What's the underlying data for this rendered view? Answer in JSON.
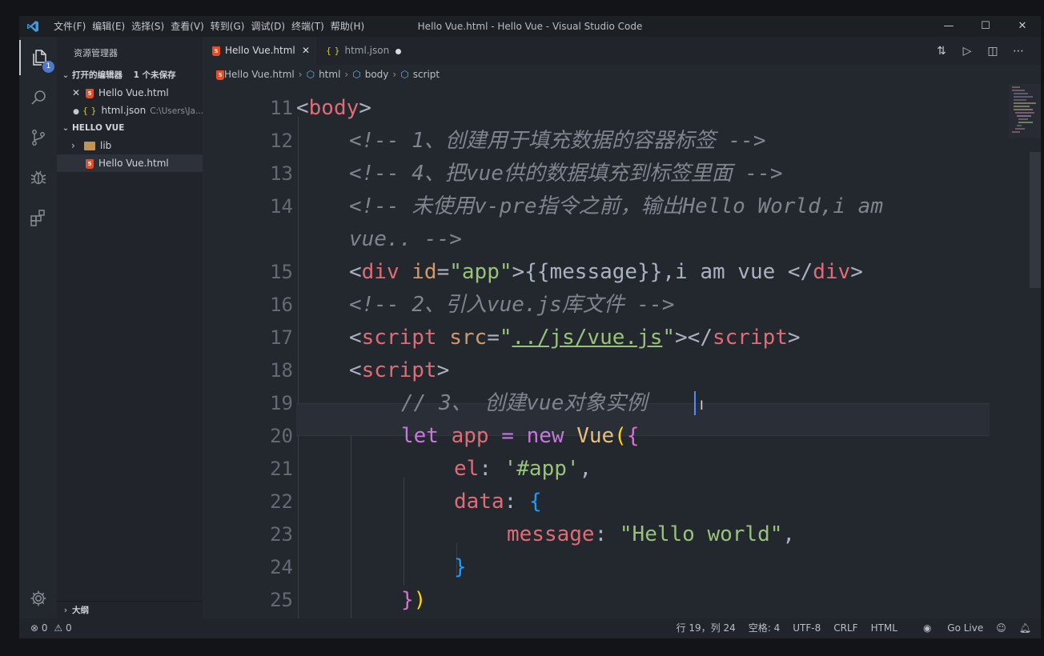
{
  "window": {
    "title": "Hello Vue.html - Hello Vue - Visual Studio Code",
    "menus": [
      "文件(F)",
      "编辑(E)",
      "选择(S)",
      "查看(V)",
      "转到(G)",
      "调试(D)",
      "终端(T)",
      "帮助(H)"
    ],
    "controls": [
      "—",
      "☐",
      "✕"
    ]
  },
  "activity": {
    "badge": "1",
    "icons": [
      "files-icon",
      "search-icon",
      "source-control-icon",
      "debug-icon",
      "extensions-icon"
    ]
  },
  "sidebar": {
    "title": "资源管理器",
    "open_editors": {
      "label": "打开的编辑器",
      "unsaved": "1 个未保存",
      "items": [
        {
          "name": "Hello Vue.html",
          "close": "✕"
        },
        {
          "name": "html.json",
          "path": "C:\\Users\\Ja..."
        }
      ]
    },
    "project": {
      "label": "HELLO VUE",
      "folders": [
        {
          "name": "lib"
        }
      ],
      "files": [
        {
          "name": "Hello Vue.html"
        }
      ]
    },
    "outline": "大纲"
  },
  "tabs": [
    {
      "label": "Hello Vue.html",
      "close": "✕"
    },
    {
      "label": "html.json"
    }
  ],
  "breadcrumbs": [
    "Hello Vue.html",
    "html",
    "body",
    "script"
  ],
  "editor": {
    "lines": [
      {
        "no": "11",
        "code": [
          "<",
          "body",
          ">"
        ]
      },
      {
        "no": "12",
        "comment": "<!-- 1、创建用于填充数据的容器标签 -->"
      },
      {
        "no": "13",
        "comment": "<!-- 4、把vue供的数据填充到标签里面 -->"
      },
      {
        "no": "14",
        "comment": "<!-- 未使用v-pre指令之前，输出Hello World,i am",
        "comment_wrap": "vue.. -->"
      },
      {
        "no": "15",
        "code": [
          "<",
          "div",
          " ",
          "id",
          "=",
          "\"app\"",
          ">",
          "{{message}},i am vue ",
          "</",
          "div",
          ">"
        ]
      },
      {
        "no": "16",
        "comment": "<!-- 2、引入vue.js库文件 -->"
      },
      {
        "no": "17",
        "code": [
          "<",
          "script",
          " ",
          "src",
          "=",
          "\"",
          "../js/vue.js",
          "\"",
          "></",
          "script",
          ">"
        ]
      },
      {
        "no": "18",
        "code": [
          "<",
          "script",
          ">"
        ]
      },
      {
        "no": "19",
        "comment": "// 3、 创建vue对象实例"
      },
      {
        "no": "20",
        "code": [
          "let",
          " ",
          "app",
          " = ",
          "new",
          " ",
          "Vue",
          "(",
          "{"
        ]
      },
      {
        "no": "21",
        "code": [
          "el",
          ": ",
          "'#app'",
          ","
        ]
      },
      {
        "no": "22",
        "code": [
          "data",
          ": ",
          "{"
        ]
      },
      {
        "no": "23",
        "code": [
          "message",
          ": ",
          "\"Hello world\"",
          ","
        ]
      },
      {
        "no": "24",
        "code": [
          "}"
        ]
      },
      {
        "no": "25",
        "code": [
          "}",
          ")"
        ]
      }
    ]
  },
  "status": {
    "errors": "0",
    "warnings": "0",
    "position": "行 19，列 24",
    "spaces": "空格: 4",
    "encoding": "UTF-8",
    "eol": "CRLF",
    "language": "HTML",
    "golive": "Go Live"
  }
}
